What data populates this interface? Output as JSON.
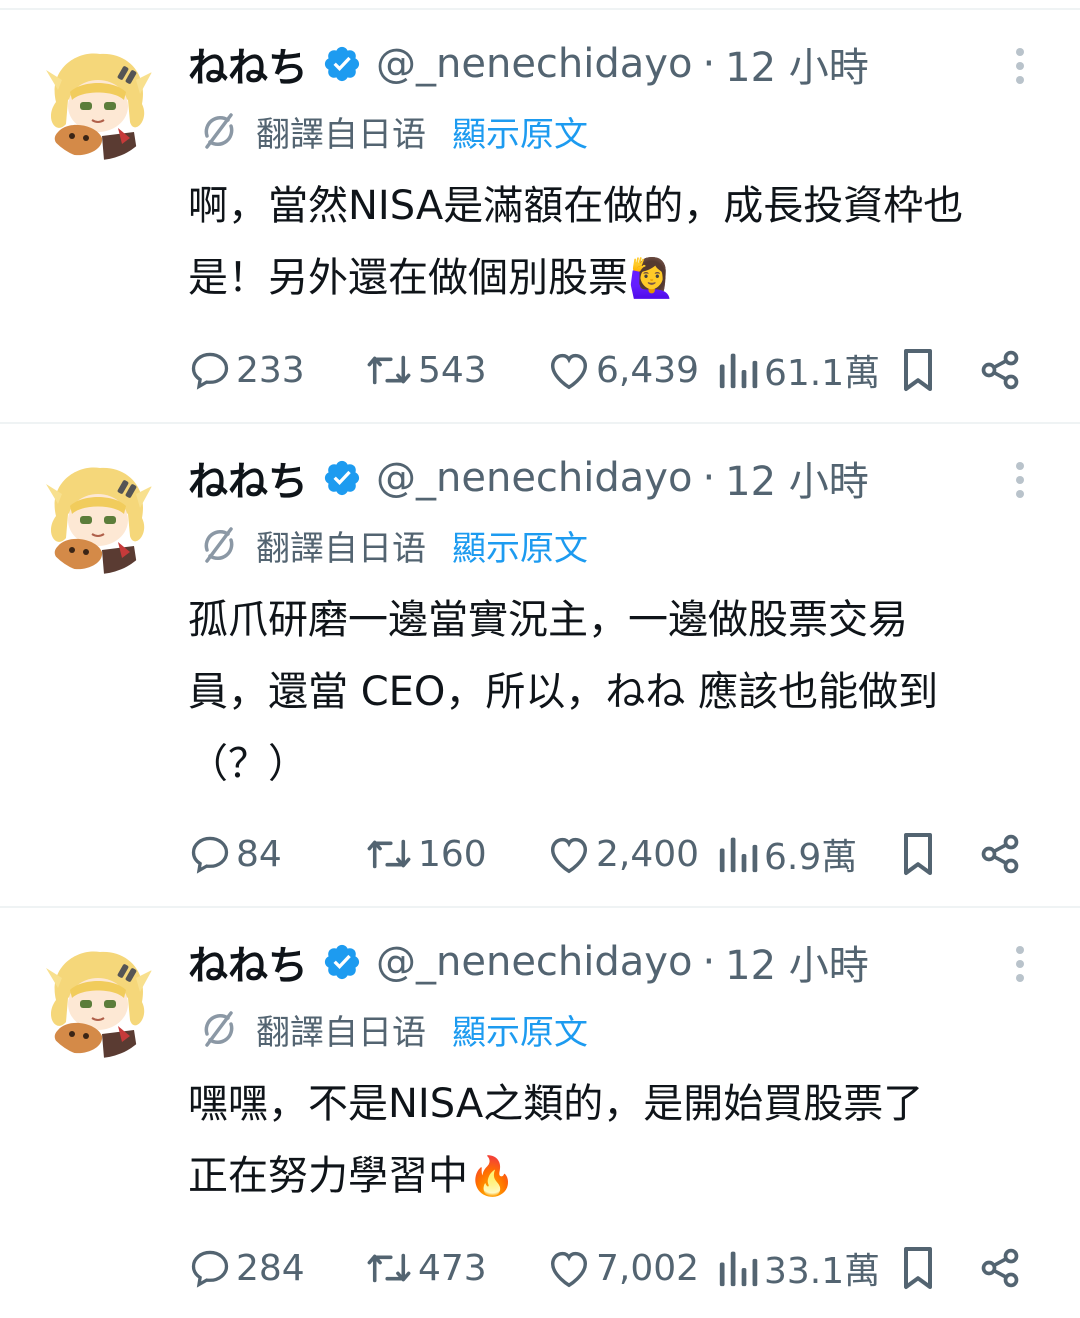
{
  "tweets": [
    {
      "display_name": "ねねち",
      "handle": "@_nenechidayo",
      "separator": "·",
      "time": "12 小時",
      "translated_from": "翻譯自日语",
      "show_original": "顯示原文",
      "lines": [
        "啊，當然NISA是滿額在做的，成長投資枠也",
        "是！另外還在做個別股票"
      ],
      "emoji": "🙋‍♀️",
      "stats": {
        "replies": "233",
        "retweets": "543",
        "likes": "6,439",
        "views": "61.1萬"
      }
    },
    {
      "display_name": "ねねち",
      "handle": "@_nenechidayo",
      "separator": "·",
      "time": "12 小時",
      "translated_from": "翻譯自日语",
      "show_original": "顯示原文",
      "lines": [
        "孤爪研磨一邊當實況主，一邊做股票交易",
        "員，還當 CEO，所以，ねね 應該也能做到",
        "（？）"
      ],
      "emoji": "",
      "stats": {
        "replies": "84",
        "retweets": "160",
        "likes": "2,400",
        "views": "6.9萬"
      }
    },
    {
      "display_name": "ねねち",
      "handle": "@_nenechidayo",
      "separator": "·",
      "time": "12 小時",
      "translated_from": "翻譯自日语",
      "show_original": "顯示原文",
      "lines": [
        "嘿嘿，不是NISA之類的，是開始買股票了",
        "正在努力學習中"
      ],
      "emoji": "🔥",
      "stats": {
        "replies": "284",
        "retweets": "473",
        "likes": "7,002",
        "views": "33.1萬"
      }
    }
  ],
  "icons": {
    "verified": "verified-badge-icon",
    "more": "more-vertical-icon",
    "translate": "translate-icon",
    "reply": "reply-icon",
    "retweet": "retweet-icon",
    "like": "heart-icon",
    "views": "views-icon",
    "bookmark": "bookmark-icon",
    "share": "share-icon"
  },
  "colors": {
    "text": "#0f1419",
    "secondary": "#536471",
    "accent": "#1d9bf0",
    "divider": "#eff3f4"
  }
}
